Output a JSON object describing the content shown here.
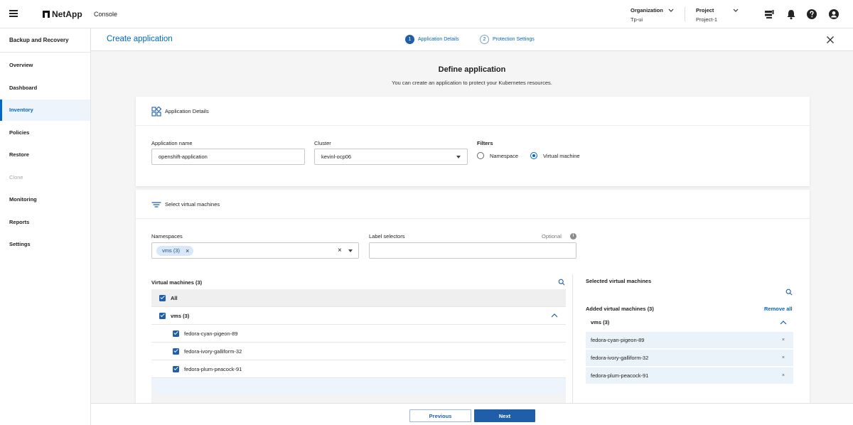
{
  "topbar": {
    "brand": "NetApp",
    "console_label": "Console",
    "organization_label": "Organization",
    "organization_value": "Tp-ui",
    "project_label": "Project",
    "project_value": "Project-1"
  },
  "sidebar": {
    "title": "Backup and Recovery",
    "items": [
      {
        "label": "Overview"
      },
      {
        "label": "Dashboard"
      },
      {
        "label": "Inventory"
      },
      {
        "label": "Policies"
      },
      {
        "label": "Restore"
      },
      {
        "label": "Clone"
      },
      {
        "label": "Monitoring"
      },
      {
        "label": "Reports"
      },
      {
        "label": "Settings"
      }
    ]
  },
  "header": {
    "title": "Create application",
    "steps": [
      {
        "num": "1",
        "label": "Application Details"
      },
      {
        "num": "2",
        "label": "Protection Settings"
      }
    ]
  },
  "page": {
    "title": "Define application",
    "subtitle": "You can create an application to protect your Kubernetes resources."
  },
  "app_details": {
    "section_title": "Application Details",
    "name_label": "Application name",
    "name_value": "openshift-application",
    "cluster_label": "Cluster",
    "cluster_value": "kevinl-ocp06",
    "filters_label": "Filters",
    "filter_namespace": "Namespace",
    "filter_vm": "Virtual machine"
  },
  "select_vms": {
    "section_title": "Select virtual machines",
    "namespaces_label": "Namespaces",
    "namespace_chip": "vms (3)",
    "label_selectors_label": "Label selectors",
    "optional_label": "Optional",
    "vm_list_title": "Virtual machines (3)",
    "all_label": "All",
    "group_label": "vms (3)",
    "vms": [
      "fedora-cyan-pigeon-89",
      "fedora-ivory-galliform-32",
      "fedora-plum-peacock-91"
    ],
    "selected_title": "Selected virtual machines",
    "added_label": "Added virtual machines (3)",
    "remove_all_label": "Remove all",
    "selected_group": "vms (3)",
    "selected_vms": [
      "fedora-cyan-pigeon-89",
      "fedora-ivory-galliform-32",
      "fedora-plum-peacock-91"
    ]
  },
  "footer": {
    "previous_label": "Previous",
    "next_label": "Next"
  },
  "colors": {
    "accent": "#0067c5",
    "button_primary": "#1f5ea8",
    "selected_bg": "#eaf2fa"
  }
}
